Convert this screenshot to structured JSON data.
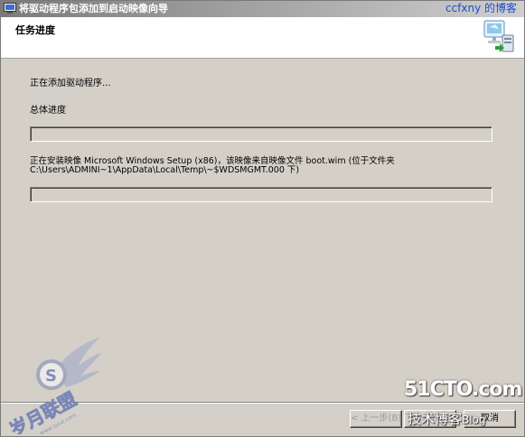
{
  "window": {
    "title": "将驱动程序包添加到启动映像向导"
  },
  "watermark_top": "ccfxny 的博客",
  "header": {
    "title": "任务进度"
  },
  "status": {
    "adding_drivers": "正在添加驱动程序...",
    "overall_progress_label": "总体进度",
    "overall_progress": 0,
    "install_line1": "正在安装映像 Microsoft Windows Setup (x86)，该映像来自映像文件 boot.wim (位于文件夹",
    "install_line2": "C:\\Users\\ADMINI~1\\AppData\\Local\\Temp\\~$WDSMGMT.000 下)",
    "image_progress": 0
  },
  "buttons": {
    "back": "< 上一步(B)",
    "next": "下一步(N) >",
    "cancel": "取消"
  },
  "watermarks": {
    "site": "51CTO.com",
    "blog": "技术博客",
    "blog_suffix": "Blog",
    "logo_text": "岁月联盟",
    "logo_url": "www.syue.com"
  },
  "colors": {
    "progress_fill": "#2a56c6",
    "link_blue": "#1c4fd0"
  }
}
